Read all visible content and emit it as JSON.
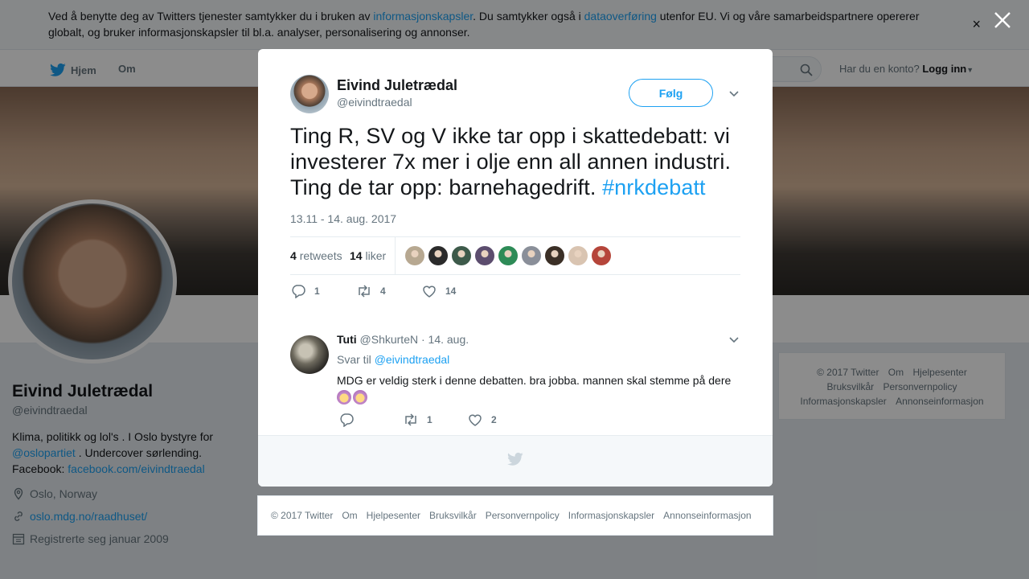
{
  "colors": {
    "accent": "#1da1f2",
    "text": "#14171a",
    "muted": "#66757f",
    "overlay": "rgba(0,0,0,0.45)"
  },
  "cookie": {
    "text_1": "Ved å benytte deg av Twitters tjenester samtykker du i bruken av ",
    "link_1": "informasjonskapsler",
    "text_2": ". Du samtykker også i ",
    "link_2": "dataoverføring",
    "text_3": " utenfor EU. Vi og våre samarbeidspartnere opererer globalt, og bruker informasjonskapsler til bl.a. analyser, personalisering og annonser.",
    "close": "×"
  },
  "nav": {
    "home": "Hjem",
    "about": "Om",
    "login_prompt": "Har du en konto?",
    "login": "Logg inn"
  },
  "profile": {
    "name": "Eivind Juletrædal",
    "handle": "@eivindtraedal",
    "bio_1": "Klima, politikk og lol's . I Oslo bystyre for ",
    "bio_link_1": "@oslopartiet",
    "bio_2": " . Undercover sørlending. Facebook: ",
    "bio_link_2": "facebook.com/eivindtraedal",
    "location": "Oslo, Norway",
    "website": "oslo.mdg.no/raadhuset/",
    "joined": "Registrerte seg januar 2009"
  },
  "right_footer": [
    "© 2017 Twitter",
    "Om",
    "Hjelpesenter",
    "Bruksvilkår",
    "Personvernpolicy",
    "Informasjonskapsler",
    "Annonseinformasjon"
  ],
  "tweet": {
    "author_name": "Eivind Juletrædal",
    "author_handle": "@eivindtraedal",
    "follow": "Følg",
    "text": "Ting R, SV og V ikke tar opp i skattedebatt: vi investerer 7x mer i olje enn all annen industri. Ting de tar opp: barnehagedrift. ",
    "hashtag": "#nrkdebatt",
    "time": "13.11 - 14. aug. 2017",
    "retweets_count": "4",
    "retweets_label": "retweets",
    "likes_count": "14",
    "likes_label": "liker",
    "liker_colors": [
      "#b7a891",
      "#2b2b2b",
      "#3d5a4a",
      "#5c4d6e",
      "#2e8b57",
      "#8a8f99",
      "#3b2f26",
      "#d9c4b1",
      "#b5453a"
    ],
    "reply_count": "1",
    "retweet_action_count": "4",
    "like_action_count": "14"
  },
  "reply": {
    "name": "Tuti",
    "handle": "@ShkurteN",
    "sep": "·",
    "date": "14. aug.",
    "reply_to_label": "Svar til ",
    "reply_to_handle": "@eivindtraedal",
    "text": "MDG er veldig sterk i denne debatten. bra jobba. mannen skal stemme på dere",
    "reply_count": "",
    "retweet_count": "1",
    "like_count": "2"
  },
  "modal_footer": [
    "© 2017 Twitter",
    "Om",
    "Hjelpesenter",
    "Bruksvilkår",
    "Personvernpolicy",
    "Informasjonskapsler",
    "Annonseinformasjon"
  ]
}
